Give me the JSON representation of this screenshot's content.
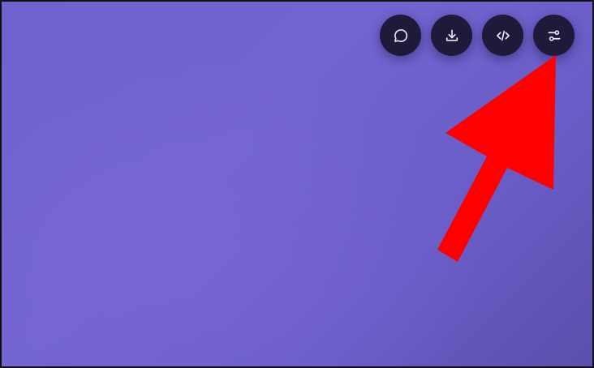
{
  "toolbar": {
    "buttons": [
      {
        "icon": "chat-bubble-icon"
      },
      {
        "icon": "download-icon"
      },
      {
        "icon": "code-icon"
      },
      {
        "icon": "sliders-icon"
      }
    ]
  },
  "colors": {
    "background": "#7063cf",
    "button": "#1f1a3a",
    "icon": "#e9e7f5",
    "arrow": "#ff0000"
  }
}
